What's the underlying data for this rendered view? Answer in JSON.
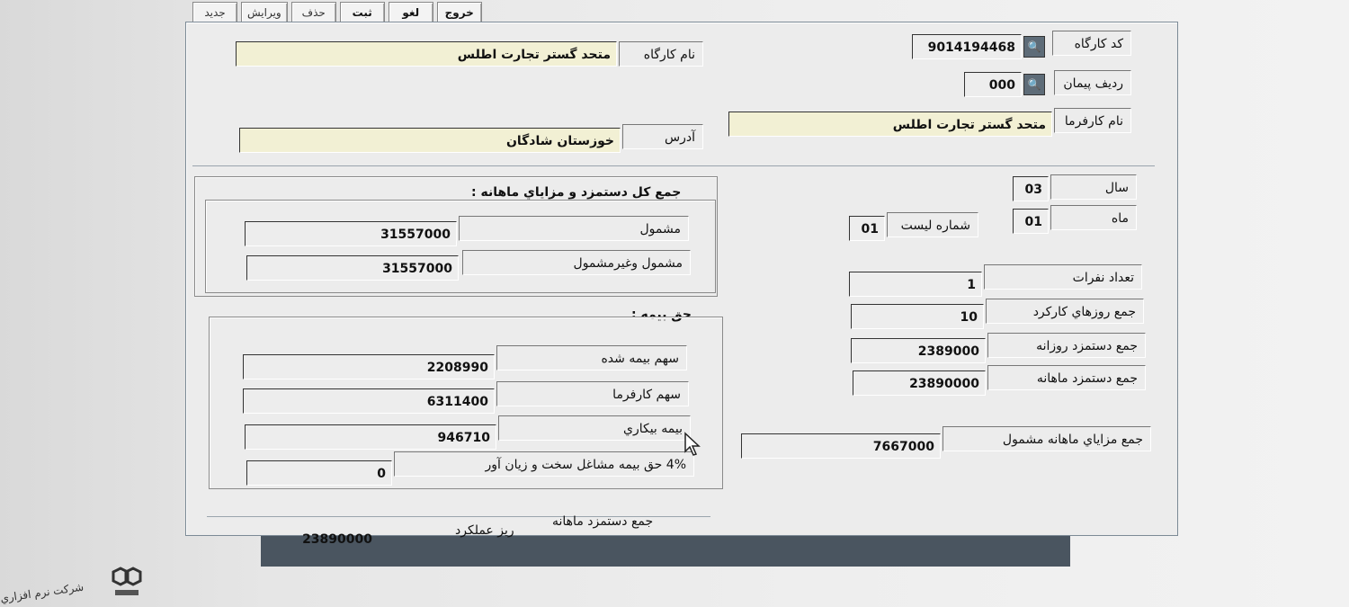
{
  "toolbar": {
    "new": "جديد",
    "edit": "ويرايش",
    "delete": "حذف",
    "save": "ثبت",
    "cancel": "لغو",
    "exit": "خروج"
  },
  "header": {
    "workshop_code_label": "کد کارگاه",
    "workshop_code": "9014194468",
    "contract_row_label": "رديف پيمان",
    "contract_row": "000",
    "workshop_name_label": "نام کارگاه",
    "workshop_name": "متحد گستر تجارت اطلس",
    "employer_name_label": "نام کارفرما",
    "employer_name": "متحد گستر تجارت اطلس",
    "address_label": "آدرس",
    "address": "خوزستان شادگان"
  },
  "period": {
    "year_label": "سال",
    "year": "03",
    "month_label": "ماه",
    "month": "01",
    "list_no_label": "شماره ليست",
    "list_no": "01"
  },
  "stats": {
    "headcount_label": "تعداد نفرات",
    "headcount": "1",
    "workdays_label": "جمع روزهاي کارکرد",
    "workdays": "10",
    "daily_wage_label": "جمع دستمزد روزانه",
    "daily_wage": "2389000",
    "monthly_wage_label": "جمع دستمزد ماهانه",
    "monthly_wage": "23890000",
    "monthly_benefits_label": "جمع مزاياي ماهانه مشمول",
    "monthly_benefits": "7667000"
  },
  "totals": {
    "title": "جمع کل دستمزد و مزاياي ماهانه :",
    "insured_label": "مشمول",
    "insured": "31557000",
    "all_label": "مشمول وغيرمشمول",
    "all": "31557000"
  },
  "insurance": {
    "title": "حق بيمه :",
    "insured_share_label": "سهم بيمه شده",
    "insured_share": "2208990",
    "employer_share_label": "سهم کارفرما",
    "employer_share": "6311400",
    "unemployment_label": "بيمه بيکاري",
    "unemployment": "946710",
    "hard_jobs_label": "4% حق بيمه مشاغل سخت و زيان آور",
    "hard_jobs": "0"
  },
  "footer": {
    "monthly_wage_label": "جمع دستمزد ماهانه",
    "detail_label": "ريز عملکرد",
    "monthly_wage": "23890000"
  },
  "logo_text": "شرکت نرم افزاري"
}
